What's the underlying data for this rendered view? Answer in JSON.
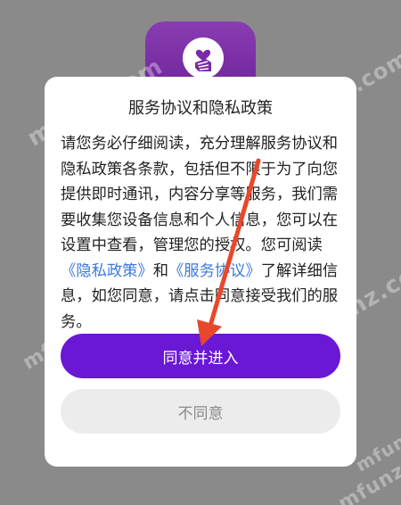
{
  "colors": {
    "background": "#8a8a8a",
    "dialog": "#ffffff",
    "primary_button": "#6a17d6",
    "secondary_button": "#ececec",
    "link": "#3a79d8",
    "annotation_arrow": "#e8472c"
  },
  "app_icon": {
    "icon": "heart-hand-icon"
  },
  "watermarks": [
    "mfunz.com",
    "mfunz.com",
    "mfunz.com",
    "mfunz.com",
    "mfunz.com",
    "mfunz.com"
  ],
  "dialog": {
    "title": "服务协议和隐私政策",
    "body": {
      "part1": "请您务必仔细阅读，充分理解服务协议和隐私政策各条款，包括但不限于为了向您提供即时通讯，内容分享等服务，我们需要收集您设备信息和个人信息，您可以在设置中查看，管理您的授权。您可阅读",
      "privacy_link": "《隐私政策》",
      "and": "和",
      "service_link": "《服务协议》",
      "part2": "了解详细信息，如您同意，请点击同意接受我们的服务。"
    },
    "agree_button": "同意并进入",
    "disagree_button": "不同意"
  }
}
